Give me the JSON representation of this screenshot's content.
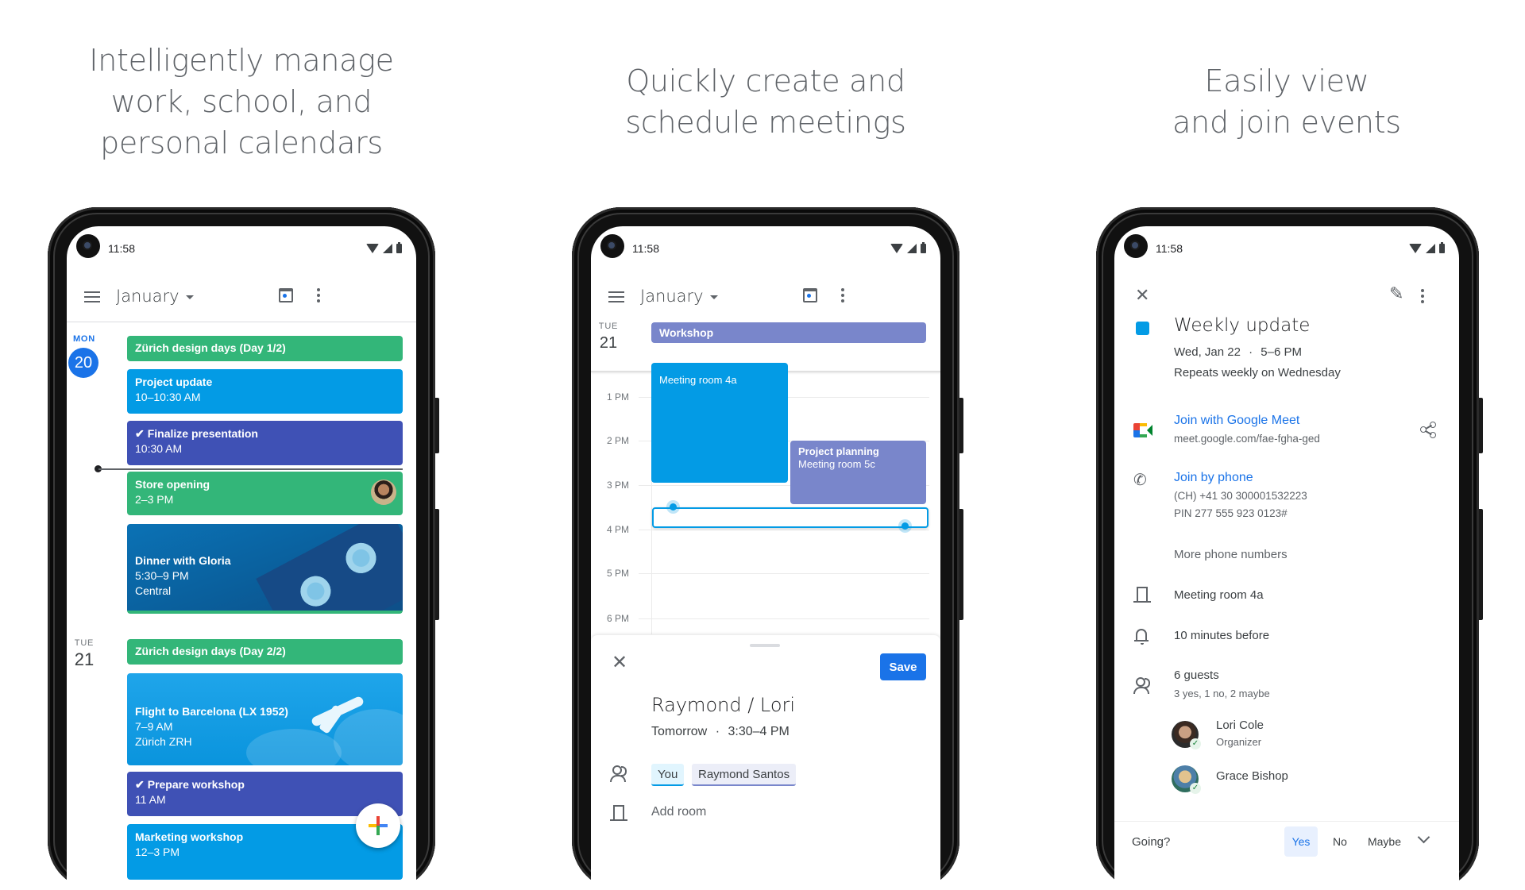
{
  "headlines": [
    [
      "Intelligently manage",
      "work, school, and",
      "personal calendars"
    ],
    [
      "Quickly create and",
      "schedule meetings"
    ],
    [
      "Easily view",
      "and join events"
    ]
  ],
  "status_bar": {
    "time": "11:58"
  },
  "colors": {
    "green": "#33b679",
    "blue": "#039be5",
    "indigo": "#3f51b5",
    "lavender": "#7986cb",
    "accent": "#1a73e8"
  },
  "schedule_phone": {
    "month": "January",
    "days": [
      {
        "dayname": "MON",
        "daynum": "20",
        "events": [
          {
            "title": "Zürich design days (Day 1/2)"
          },
          {
            "title": "Project update",
            "time": "10–10:30 AM"
          },
          {
            "title": "Finalize presentation",
            "time": "10:30 AM",
            "task": true
          },
          {
            "title": "Store opening",
            "time": "2–3 PM"
          },
          {
            "title": "Dinner with Gloria",
            "time": "5:30–9 PM",
            "location": "Central"
          }
        ]
      },
      {
        "dayname": "TUE",
        "daynum": "21",
        "events": [
          {
            "title": "Zürich design days (Day 2/2)"
          },
          {
            "title": "Flight to Barcelona (LX 1952)",
            "time": "7–9 AM",
            "location": "Zürich ZRH"
          },
          {
            "title": "Prepare workshop",
            "time": "11 AM",
            "task": true
          },
          {
            "title": "Marketing workshop",
            "time": "12–3 PM"
          }
        ]
      }
    ],
    "task_check": "✔",
    "fab_label": "+"
  },
  "create_phone": {
    "month": "January",
    "dayname": "TUE",
    "daynum": "21",
    "allday_event": "Workshop",
    "hours": [
      "1 PM",
      "2 PM",
      "3 PM",
      "4 PM",
      "5 PM",
      "6 PM"
    ],
    "events": [
      {
        "title": "Meeting room 4a"
      },
      {
        "title": "Project planning",
        "location": "Meeting room 5c"
      }
    ],
    "sheet": {
      "save_label": "Save",
      "title": "Raymond / Lori",
      "when": "Tomorrow",
      "time": "3:30–4 PM",
      "separator": "·",
      "guests": [
        "You",
        "Raymond Santos"
      ],
      "add_room": "Add room"
    }
  },
  "detail_phone": {
    "title": "Weekly update",
    "date": "Wed, Jan 22",
    "time": "5–6 PM",
    "separator": "·",
    "recurrence": "Repeats weekly on Wednesday",
    "meet": {
      "label": "Join with Google Meet",
      "url": "meet.google.com/fae-fgha-ged"
    },
    "phone": {
      "label": "Join by phone",
      "number": "(CH) +41 30 300001532223",
      "pin": "PIN 277 555 923 0123#"
    },
    "more_phone": "More phone numbers",
    "room": "Meeting room 4a",
    "reminder": "10 minutes before",
    "guests_count": "6 guests",
    "guests_summary": "3 yes, 1 no, 2 maybe",
    "guests": [
      {
        "name": "Lori Cole",
        "role": "Organizer"
      },
      {
        "name": "Grace Bishop",
        "role": ""
      }
    ],
    "rsvp": {
      "prompt": "Going?",
      "yes": "Yes",
      "no": "No",
      "maybe": "Maybe",
      "selected": "Yes"
    }
  }
}
